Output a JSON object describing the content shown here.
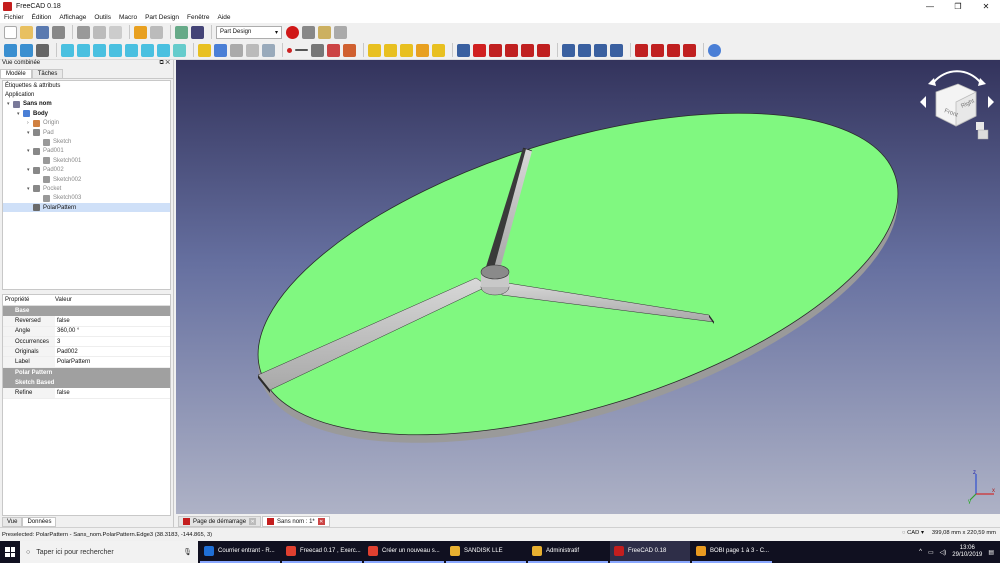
{
  "window": {
    "title": "FreeCAD 0.18",
    "min": "—",
    "max": "❐",
    "close": "✕"
  },
  "menu": [
    "Fichier",
    "Édition",
    "Affichage",
    "Outils",
    "Macro",
    "Part Design",
    "Fenêtre",
    "Aide"
  ],
  "workbench": {
    "selected": "Part Design"
  },
  "combo_view": {
    "title": "Vue combinée",
    "tabs": [
      "Modèle",
      "Tâches"
    ],
    "labels_header": "Étiquettes & attributs",
    "application": "Application",
    "tree": [
      {
        "label": "Sans nom",
        "level": 0,
        "arrow": "▾",
        "bold": true,
        "color": "#7a7a9a"
      },
      {
        "label": "Body",
        "level": 1,
        "arrow": "▾",
        "bold": true,
        "color": "#4a7fd6"
      },
      {
        "label": "Origin",
        "level": 2,
        "arrow": "›",
        "dim": true,
        "color": "#d08040"
      },
      {
        "label": "Pad",
        "level": 2,
        "arrow": "▾",
        "dim": true,
        "color": "#888"
      },
      {
        "label": "Sketch",
        "level": 3,
        "arrow": "",
        "dim": true,
        "color": "#999"
      },
      {
        "label": "Pad001",
        "level": 2,
        "arrow": "▾",
        "dim": true,
        "color": "#888"
      },
      {
        "label": "Sketch001",
        "level": 3,
        "arrow": "",
        "dim": true,
        "color": "#999"
      },
      {
        "label": "Pad002",
        "level": 2,
        "arrow": "▾",
        "dim": true,
        "color": "#888"
      },
      {
        "label": "Sketch002",
        "level": 3,
        "arrow": "",
        "dim": true,
        "color": "#999"
      },
      {
        "label": "Pocket",
        "level": 2,
        "arrow": "▾",
        "dim": true,
        "color": "#888"
      },
      {
        "label": "Sketch003",
        "level": 3,
        "arrow": "",
        "dim": true,
        "color": "#999"
      },
      {
        "label": "PolarPattern",
        "level": 2,
        "arrow": "",
        "selected": true,
        "color": "#6a6a6a"
      }
    ],
    "properties": {
      "head_property": "Propriété",
      "head_value": "Valeur",
      "groups": [
        {
          "name": "Base",
          "rows": [
            {
              "k": "Reversed",
              "v": "false"
            },
            {
              "k": "Angle",
              "v": "360,00 °"
            },
            {
              "k": "Occurrences",
              "v": "3"
            },
            {
              "k": "Originals",
              "v": "Pad002"
            },
            {
              "k": "Label",
              "v": "PolarPattern"
            }
          ]
        },
        {
          "name": "Polar Pattern",
          "rows": []
        },
        {
          "name": "Sketch Based",
          "rows": [
            {
              "k": "Refine",
              "v": "false"
            }
          ]
        }
      ]
    },
    "bottom_tabs": [
      "Vue",
      "Données"
    ]
  },
  "navcube": {
    "front": "Front",
    "right": "Right"
  },
  "axes": {
    "x": "x",
    "y": "y",
    "z": "z"
  },
  "doc_tabs": [
    {
      "label": "Page de démarrage",
      "active": false
    },
    {
      "label": "Sans nom : 1*",
      "active": true
    }
  ],
  "status": {
    "preselected": "Preselected: PolarPattern - Sans_nom.PolarPattern.Edge3 (38.3183, -144.865, 3)",
    "nav_style": "CAD",
    "dimensions": "399,08 mm x 220,59 mm"
  },
  "taskbar": {
    "search_placeholder": "Taper ici pour rechercher",
    "apps": [
      {
        "label": "Courrier entrant - R...",
        "color": "#1f6fd6"
      },
      {
        "label": "Freecad 0.17 , Exerc...",
        "color": "#e04030"
      },
      {
        "label": "Créer un nouveau s...",
        "color": "#e04030"
      },
      {
        "label": "SANDISK LLE",
        "color": "#e8b030"
      },
      {
        "label": "Administratif",
        "color": "#e8b030"
      },
      {
        "label": "FreeCAD 0.18",
        "color": "#c41e1e",
        "active": true
      },
      {
        "label": "BOBI page 1 à 3 - C...",
        "color": "#e89a20"
      }
    ],
    "time": "13:06",
    "date": "29/10/2019"
  },
  "colors": {
    "face": "#80f880",
    "solid": "#c4c4c4",
    "accent": "#4a7fd6"
  }
}
